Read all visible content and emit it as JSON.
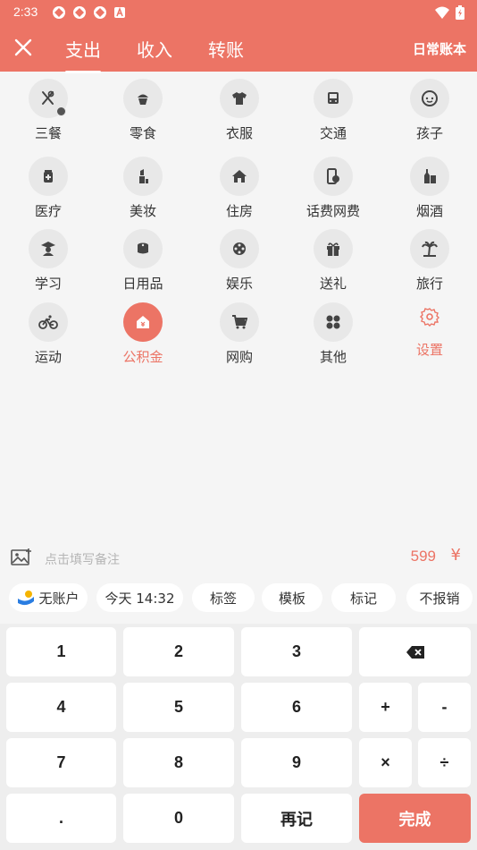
{
  "status": {
    "time": "2:33"
  },
  "header": {
    "tabs": [
      "支出",
      "收入",
      "转账"
    ],
    "account": "日常账本",
    "colors": {
      "accent": "#ec7465"
    }
  },
  "categories": [
    {
      "label": "三餐",
      "icon": "utensils-icon"
    },
    {
      "label": "零食",
      "icon": "cupcake-icon"
    },
    {
      "label": "衣服",
      "icon": "shirt-icon"
    },
    {
      "label": "交通",
      "icon": "bus-icon"
    },
    {
      "label": "孩子",
      "icon": "baby-icon"
    },
    {
      "label": "医疗",
      "icon": "medicine-icon"
    },
    {
      "label": "美妆",
      "icon": "lipstick-icon"
    },
    {
      "label": "住房",
      "icon": "house-icon"
    },
    {
      "label": "话费网费",
      "icon": "phone-bill-icon"
    },
    {
      "label": "烟酒",
      "icon": "bottle-icon"
    },
    {
      "label": "学习",
      "icon": "graduate-icon"
    },
    {
      "label": "日用品",
      "icon": "tissue-icon"
    },
    {
      "label": "娱乐",
      "icon": "film-icon"
    },
    {
      "label": "送礼",
      "icon": "gift-icon"
    },
    {
      "label": "旅行",
      "icon": "palm-tree-icon"
    },
    {
      "label": "运动",
      "icon": "bicycle-icon"
    },
    {
      "label": "公积金",
      "icon": "fund-house-icon"
    },
    {
      "label": "网购",
      "icon": "cart-icon"
    },
    {
      "label": "其他",
      "icon": "grid-icon"
    },
    {
      "label": "设置",
      "icon": "gear-icon"
    }
  ],
  "note": {
    "placeholder": "点击填写备注",
    "amount": "599",
    "currency": "¥"
  },
  "chips": {
    "account": "无账户",
    "date": "今天 14:32",
    "tag": "标签",
    "template": "模板",
    "mark": "标记",
    "reimburse": "不报销"
  },
  "keys": {
    "k1": "1",
    "k2": "2",
    "k3": "3",
    "k4": "4",
    "k5": "5",
    "k6": "6",
    "plus": "+",
    "minus": "-",
    "k7": "7",
    "k8": "8",
    "k9": "9",
    "times": "×",
    "divide": "÷",
    "dot": ".",
    "k0": "0",
    "again": "再记",
    "done": "完成"
  }
}
